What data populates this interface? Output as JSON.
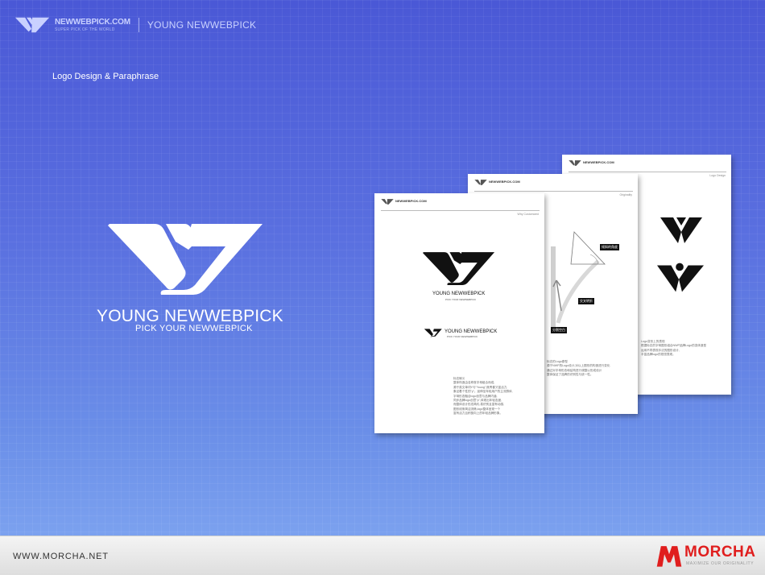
{
  "header": {
    "brand_site": "NEWWEBPICK.COM",
    "brand_tagline": "SUPER PICK OF THE WORLD",
    "brand_name": "YOUNG NEWWEBPICK"
  },
  "section_title": "Logo Design & Paraphrase",
  "showcase": {
    "name": "YOUNG NEWWEBPICK",
    "tagline": "PICK YOUR NEWWEBPICK"
  },
  "sheets": {
    "front": {
      "brand": "NEWWEBPICK.COM",
      "label": "Why Customized",
      "logo_name": "YOUNG NEWWEBPICK",
      "logo_sub": "PICK YOUR NEWWEBPICK",
      "h_logo_name": "YOUNG NEWWEBPICK",
      "h_logo_sub": "PICK YOUR NEWWEBPICK",
      "text_title": "标志释义",
      "text_lines": [
        "整体构造由名称首字母组合而成,",
        "源于英文单词Y与\"Young\",既青春又富活力,",
        "象征着个性的\"y\"。延伸至年轻用户的主流群体,",
        "字母形态融合logo创意与品牌内涵,",
        "同步品牌logo创意\"p\",体现出年轻态度,",
        "而整体设计形态简约,易识别且富有动感,",
        "图形线条简洁流畅,logo整体呈现一个",
        "富有活力且积极向上的年轻品牌形象。"
      ]
    },
    "middle": {
      "brand": "NEWWEBPICK.COM",
      "label": "Originality",
      "tag1": "倾斜的角度",
      "tag2": "交叉转折",
      "tag3": "分割空白",
      "text_title": "标志的Logo原型",
      "text_lines": [
        "源于NWP的Logo设计,对以上图形的构造进行变化",
        "通过对字母形态和结构进行调整以形成设计",
        "整体保证了品牌的识别性与统一性。"
      ]
    },
    "back": {
      "brand": "NEWWEBPICK.COM",
      "label": "Logo Design",
      "text_title": "Logo变形上的表现",
      "text_lines": [
        "根据标志的字母图形组合NWP品牌Logo的变体造型",
        "运用不同表现手法的图形设计,",
        "丰富品牌logo的视觉表现。"
      ]
    }
  },
  "footer": {
    "url": "WWW.MORCHA.NET",
    "brand": "MORCHA",
    "tagline": "MAXIMIZE OUR ORIGINALITY"
  },
  "colors": {
    "background_top": "#4a58d6",
    "background_bottom": "#7ba1ef",
    "accent_red": "#e01e1e",
    "footer_bg": "#e8e8e8"
  }
}
